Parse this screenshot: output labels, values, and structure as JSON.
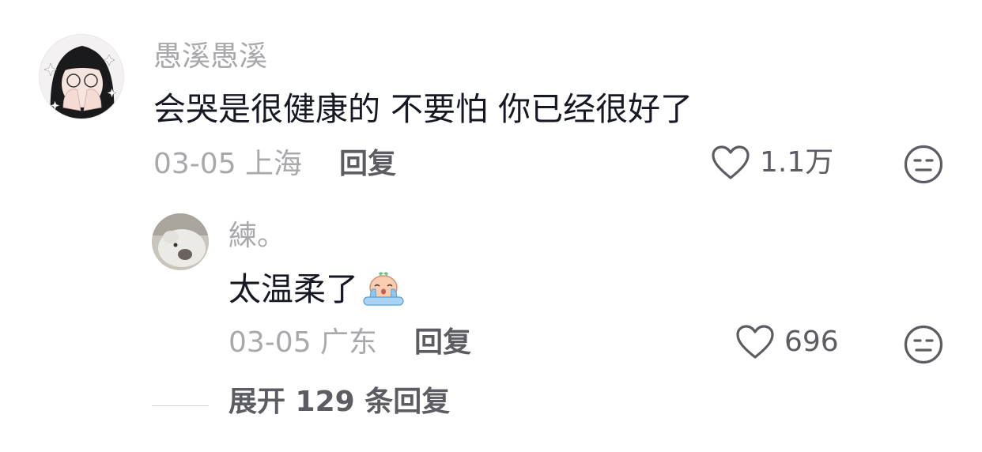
{
  "comment": {
    "username": "愚溪愚溪",
    "text": "会哭是很健康的 不要怕 你已经很好了",
    "date_location": "03-05 上海",
    "reply_label": "回复",
    "like_count": "1.1万",
    "like_icon": "heart-outline-icon",
    "dislike_icon": "meh-face-icon",
    "avatar": "avatar-girl-hands-over-face"
  },
  "reply": {
    "username": "練。",
    "text": "太温柔了",
    "emoji": "crying-emoji",
    "date_location": "03-05 广东",
    "reply_label": "回复",
    "like_count": "696",
    "like_icon": "heart-outline-icon",
    "dislike_icon": "meh-face-icon",
    "avatar": "avatar-white-dog"
  },
  "expand_replies": "展开 129 条回复",
  "colors": {
    "text_primary": "#161823",
    "text_secondary": "#a8a8ad",
    "action_text": "#5c5c63",
    "background": "#ffffff"
  }
}
